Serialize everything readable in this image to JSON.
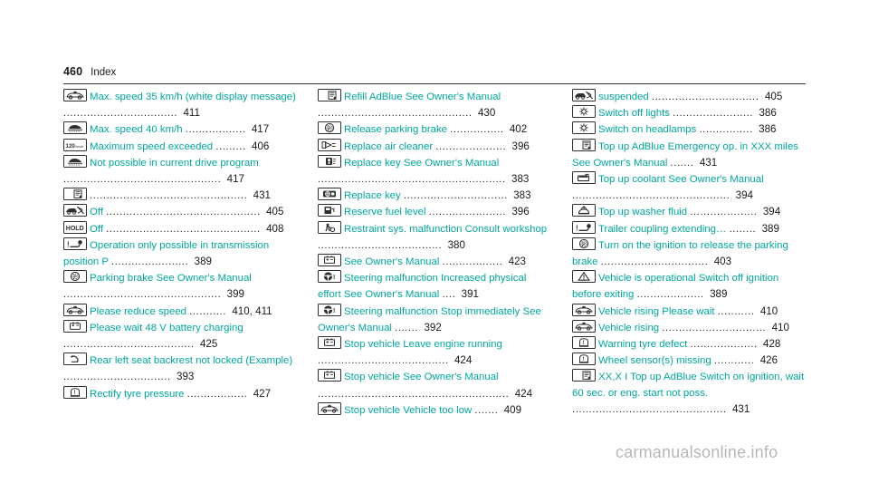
{
  "header": {
    "page_number": "460",
    "section_title": "Index"
  },
  "watermark": "carmanualsonline.info",
  "colors": {
    "entry_text": "#00a79d",
    "body_text": "#1a1a1a",
    "watermark": "#b7b7b7",
    "rule": "#2b2b2b"
  },
  "columns": [
    {
      "name": "column-1",
      "entries": [
        {
          "icon": "car-lowered-icon",
          "label": "Max. speed 35 km/h (white display message)",
          "leader": "..................................",
          "page": "411"
        },
        {
          "icon": "engine-restricted-icon",
          "label": "Max. speed 40 km/h",
          "leader": "..................",
          "page": "417"
        },
        {
          "icon": "speed-limit-120-icon",
          "label": "Maximum speed exceeded",
          "leader": ".........",
          "page": "406"
        },
        {
          "icon": "engine-restricted-icon",
          "label": "Not possible in current drive program",
          "leader": "...............................................",
          "page": "417"
        },
        {
          "icon": "adblue-icon",
          "label": "",
          "leader": "...............................................",
          "page": "431"
        },
        {
          "icon": "distance-warning-off-icon",
          "label": "Off",
          "leader": "..............................................",
          "page": "405"
        },
        {
          "icon": "hold-icon",
          "label": "Off",
          "leader": "..............................................",
          "page": "408"
        },
        {
          "icon": "trailer-coupling-icon",
          "label": "Operation only possible in transmission position P",
          "leader": ".......................",
          "page": "389"
        },
        {
          "icon": "parking-brake-icon",
          "label": "Parking brake See Owner's Manual",
          "leader": "...............................................",
          "page": "399"
        },
        {
          "icon": "car-lowered-icon",
          "label": "Please reduce speed",
          "leader": "...........",
          "page": "410, 411"
        },
        {
          "icon": "battery-48v-icon",
          "label": "Please wait 48 V battery charging",
          "leader": ".......................................",
          "page": "425"
        },
        {
          "icon": "seat-backrest-icon",
          "label": "Rear left seat backrest not locked (Example)",
          "leader": "................................",
          "page": "393"
        },
        {
          "icon": "tyre-pressure-icon",
          "label": "Rectify tyre pressure",
          "leader": "..................",
          "page": "427"
        }
      ]
    },
    {
      "name": "column-2",
      "entries": [
        {
          "icon": "adblue-icon",
          "label": "Refill AdBlue See Owner's Manual",
          "leader": "..............................................",
          "page": "430"
        },
        {
          "icon": "parking-brake-icon",
          "label": "Release parking brake",
          "leader": "................",
          "page": "402"
        },
        {
          "icon": "air-cleaner-icon",
          "label": "Replace air cleaner",
          "leader": ".....................",
          "page": "396"
        },
        {
          "icon": "replace-key-icon",
          "label": "Replace key See Owner's Manual",
          "leader": "........................................................",
          "page": "383"
        },
        {
          "icon": "key-battery-icon",
          "label": "Replace key",
          "leader": "...............................",
          "page": "383"
        },
        {
          "icon": "fuel-reserve-icon",
          "label": "Reserve fuel level",
          "leader": ".......................",
          "page": "396"
        },
        {
          "icon": "restraint-system-icon",
          "label": "Restraint sys. malfunction Consult workshop",
          "leader": ".....................................",
          "page": "380"
        },
        {
          "icon": "battery-icon",
          "label": "See Owner's Manual",
          "leader": "..................",
          "page": "423"
        },
        {
          "icon": "steering-malfunction-icon",
          "label": "Steering malfunction Increased physical effort See Owner's Manual",
          "leader": "....",
          "page": "391"
        },
        {
          "icon": "steering-malfunction-icon",
          "label": "Steering malfunction Stop immediately See Owner's Manual",
          "leader": ".......",
          "page": "392"
        },
        {
          "icon": "battery-icon",
          "label": "Stop vehicle Leave engine running",
          "leader": ".......................................",
          "page": "424"
        },
        {
          "icon": "battery-icon",
          "label": "Stop vehicle See Owner's Manual",
          "leader": ".........................................................",
          "page": "424"
        },
        {
          "icon": "car-lowered-icon",
          "label": "Stop vehicle Vehicle too low",
          "leader": ".......",
          "page": "409"
        }
      ]
    },
    {
      "name": "column-3",
      "entries": [
        {
          "icon": "distance-warning-off-icon",
          "label": "suspended",
          "leader": "................................",
          "page": "405"
        },
        {
          "icon": "lights-icon",
          "label": "Switch off lights",
          "leader": "........................",
          "page": "386"
        },
        {
          "icon": "lights-icon",
          "label": "Switch on headlamps",
          "leader": "................",
          "page": "386"
        },
        {
          "icon": "adblue-icon",
          "label": "Top up AdBlue Emergency op. in XXX miles See Owner's Manual",
          "leader": ".......",
          "page": "431"
        },
        {
          "icon": "coolant-icon",
          "label": "Top up coolant See Owner's Manual",
          "leader": "...............................................",
          "page": "394"
        },
        {
          "icon": "washer-fluid-icon",
          "label": "Top up washer fluid",
          "leader": "....................",
          "page": "394"
        },
        {
          "icon": "trailer-coupling-icon",
          "label": "Trailer coupling extending…",
          "leader": "........",
          "page": "389"
        },
        {
          "icon": "parking-brake-icon",
          "label": "Turn on the ignition to release the parking brake",
          "leader": "................................",
          "page": "403"
        },
        {
          "icon": "warning-triangle-icon",
          "label": "Vehicle is operational Switch off ignition before exiting",
          "leader": "....................",
          "page": "389"
        },
        {
          "icon": "car-lowered-icon",
          "label": "Vehicle rising Please wait",
          "leader": "...........",
          "page": "410"
        },
        {
          "icon": "car-lowered-icon",
          "label": "Vehicle rising",
          "leader": "...............................",
          "page": "410"
        },
        {
          "icon": "tyre-pressure-icon",
          "label": "Warning tyre defect",
          "leader": "....................",
          "page": "428"
        },
        {
          "icon": "tyre-pressure-icon",
          "label": "Wheel sensor(s) missing",
          "leader": "............",
          "page": "426"
        },
        {
          "icon": "adblue-icon",
          "label": "XX,X I Top up AdBlue Switch on ignition, wait 60 sec. or eng. start not poss.",
          "leader": "..............................................",
          "page": "431"
        }
      ]
    }
  ]
}
